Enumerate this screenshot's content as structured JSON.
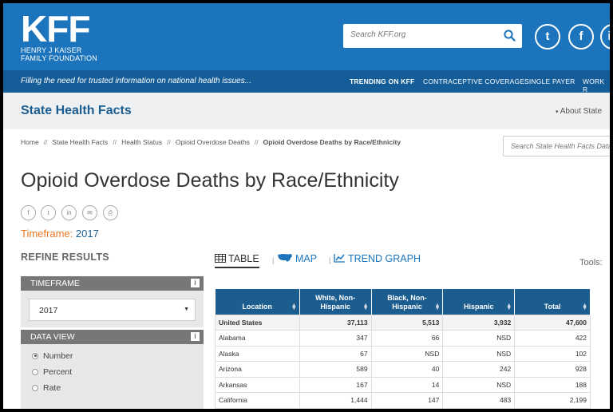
{
  "header": {
    "logo_text": "KFF",
    "logo_sub_1": "HENRY J KAISER",
    "logo_sub_2": "FAMILY FOUNDATION",
    "search_placeholder": "Search KFF.org",
    "social": [
      "t",
      "f",
      "in"
    ],
    "icons": [
      "search-icon",
      "twitter-icon",
      "facebook-icon",
      "linkedin-icon"
    ]
  },
  "tagbar": {
    "tagline": "Filling the need for trusted information on national health issues...",
    "trending_label": "TRENDING ON KFF",
    "links": [
      "CONTRACEPTIVE COVERAGE",
      "SINGLE PAYER",
      "WORK R"
    ]
  },
  "section": {
    "title": "State Health Facts",
    "about": "About State"
  },
  "breadcrumb": [
    "Home",
    "State Health Facts",
    "Health Status",
    "Opioid Overdose Deaths",
    "Opioid Overdose Deaths by Race/Ethnicity"
  ],
  "breadcrumb_sep": "//",
  "site_search_placeholder": "Search State Health Facts Data",
  "page": {
    "title": "Opioid Overdose Deaths by Race/Ethnicity",
    "share_icons": [
      "facebook-icon",
      "twitter-icon",
      "linkedin-icon",
      "email-icon",
      "print-icon"
    ],
    "timeframe_label": "Timeframe:",
    "timeframe_value": "2017"
  },
  "refine": {
    "title": "REFINE RESULTS",
    "timeframe_header": "TIMEFRAME",
    "timeframe_selected": "2017",
    "dataview_header": "DATA VIEW",
    "info": "i",
    "options": [
      {
        "label": "Number",
        "selected": true
      },
      {
        "label": "Percent",
        "selected": false
      },
      {
        "label": "Rate",
        "selected": false
      }
    ]
  },
  "views": {
    "table": "TABLE",
    "map": "MAP",
    "trend": "TREND GRAPH",
    "tools": "Tools:"
  },
  "table": {
    "headers": [
      "Location",
      "White, Non-Hispanic",
      "Black, Non-Hispanic",
      "Hispanic",
      "Total"
    ],
    "rows": [
      [
        "United States",
        "37,113",
        "5,513",
        "3,932",
        "47,600"
      ],
      [
        "Alabama",
        "347",
        "66",
        "NSD",
        "422"
      ],
      [
        "Alaska",
        "67",
        "NSD",
        "NSD",
        "102"
      ],
      [
        "Arizona",
        "589",
        "40",
        "242",
        "928"
      ],
      [
        "Arkansas",
        "167",
        "14",
        "NSD",
        "188"
      ],
      [
        "California",
        "1,444",
        "147",
        "483",
        "2,199"
      ]
    ]
  },
  "colors": {
    "brand_blue": "#1c75bc",
    "dark_blue": "#145d98",
    "header_blue": "#1c5d90",
    "orange": "#e87722"
  }
}
